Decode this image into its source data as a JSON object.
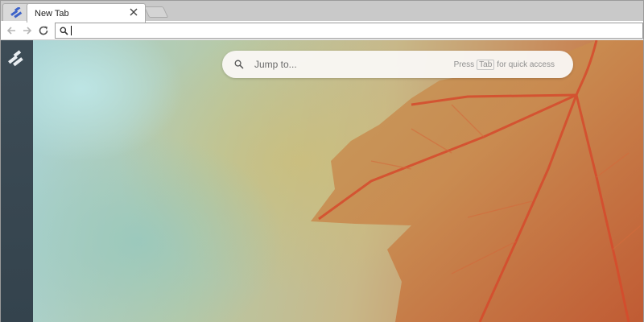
{
  "browser": {
    "active_tab_title": "New Tab",
    "address_value": ""
  },
  "icons": {
    "app_tab": "app-logo-icon",
    "tab_close": "close-icon",
    "back": "arrow-left-icon",
    "forward": "arrow-right-icon",
    "reload": "reload-icon",
    "omnibox": "search-icon",
    "sidebar": "app-logo-icon",
    "jump": "search-icon"
  },
  "jump_bar": {
    "placeholder": "Jump to...",
    "hint_prefix": "Press",
    "hint_key": "Tab",
    "hint_suffix": "for quick access"
  },
  "colors": {
    "sidebar": "#3d4c56",
    "logo_blue": "#3e63c9",
    "leaf": "#c6663a"
  }
}
